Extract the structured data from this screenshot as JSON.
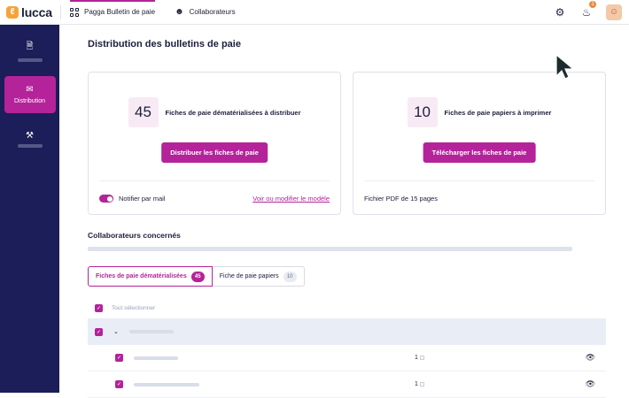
{
  "topbar": {
    "brand": "lucca",
    "brand_badge": "ℓ",
    "apps": [
      {
        "label": "Pagga Bulletin de paie",
        "active": true
      },
      {
        "label": "Collaborateurs",
        "active": false
      }
    ],
    "notification_count": "1"
  },
  "sidebar": {
    "items": [
      {
        "icon": "document-icon",
        "label": "",
        "active": false
      },
      {
        "icon": "mail-icon",
        "label": "Distribution",
        "active": true
      },
      {
        "icon": "tools-icon",
        "label": "",
        "active": false
      }
    ]
  },
  "main": {
    "title": "Distribution des bulletins de paie",
    "card_digital": {
      "count": "45",
      "label": "Fiches de paie dématérialisées à distribuer",
      "button": "Distribuer les fiches de paie",
      "toggle_label": "Notifier par mail",
      "toggle_on": true,
      "link": "Voir ou modifier le modèle"
    },
    "card_paper": {
      "count": "10",
      "label": "Fiches de paie papiers à imprimer",
      "button": "Télécharger les fiches de paie",
      "footer": "Fichier PDF de 15 pages"
    },
    "section_title": "Collaborateurs concernés",
    "tabs": [
      {
        "label": "Fiches de paie dématérialisées",
        "count": "45",
        "active": true
      },
      {
        "label": "Fiche de paie papiers",
        "count": "10",
        "active": false
      }
    ],
    "select_all": "Tout sélectionner",
    "rows": [
      {
        "qty": "1"
      },
      {
        "qty": "1"
      }
    ]
  },
  "colors": {
    "accent": "#b4239a",
    "sidebar": "#1b1e58",
    "group_row": "#e9edf6"
  }
}
